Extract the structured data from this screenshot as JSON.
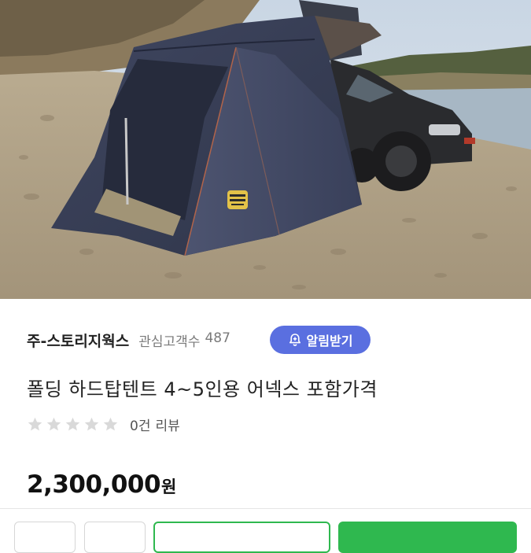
{
  "seller": {
    "name": "주-스토리지웍스",
    "followers_label": "관심고객수",
    "followers_count": "487",
    "alarm_button_label": "알림받기"
  },
  "product": {
    "title": "폴딩 하드탑텐트 4~5인용 어넥스 포함가격",
    "rating": 0,
    "rating_max": 5,
    "review_count": "0건",
    "review_label": "리뷰",
    "price": "2,300,000",
    "currency": "원"
  },
  "colors": {
    "alarm_button": "#5a6fe0",
    "buy_green": "#2fb84f",
    "star_empty": "#d9d9d9"
  },
  "icons": {
    "alarm": "bell-plus-icon",
    "rating": "star-icon"
  }
}
